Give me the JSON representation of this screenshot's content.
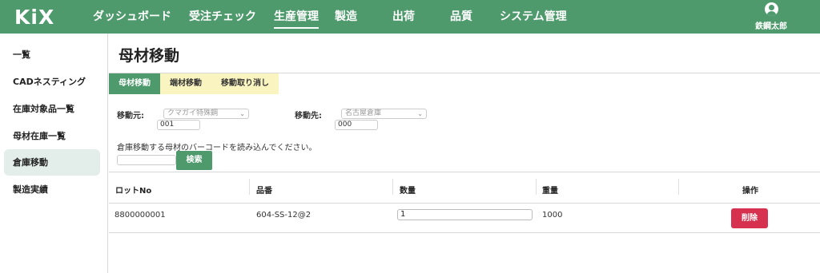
{
  "header": {
    "logo": "KiX",
    "nav": [
      "ダッシュボード",
      "受注チェック",
      "生産管理",
      "製造",
      "出荷",
      "品質",
      "システム管理"
    ],
    "active_nav": "生産管理",
    "user_name": "鉄鋼太郎",
    "color": "#4e9a6d"
  },
  "sidebar": {
    "items": [
      "一覧",
      "CADネスティング",
      "在庫対象品一覧",
      "母材在庫一覧",
      "倉庫移動",
      "製造実績"
    ],
    "active": "倉庫移動"
  },
  "page": {
    "title": "母材移動",
    "tabs": [
      "母材移動",
      "端材移動",
      "移動取り消し"
    ],
    "active_tab": "母材移動"
  },
  "form": {
    "from_label": "移動元:",
    "from_value": "クマガイ特殊鋼",
    "from_code": "001",
    "to_label": "移動先:",
    "to_value": "名古屋倉庫",
    "to_code": "000",
    "instruction": "倉庫移動する母材のバーコードを読み込んでください。",
    "barcode_value": "",
    "search_label": "検索"
  },
  "table": {
    "columns": [
      "ロットNo",
      "品番",
      "数量",
      "重量",
      "操作"
    ],
    "rows": [
      {
        "lot": "8800000001",
        "part": "604-SS-12@2",
        "qty": "1",
        "weight": "1000",
        "action": "削除"
      }
    ]
  },
  "colors": {
    "primary": "#4e9a6d",
    "danger": "#d6314e",
    "tab_inactive": "#faf4c0",
    "sidebar_active": "#e3eeea"
  }
}
